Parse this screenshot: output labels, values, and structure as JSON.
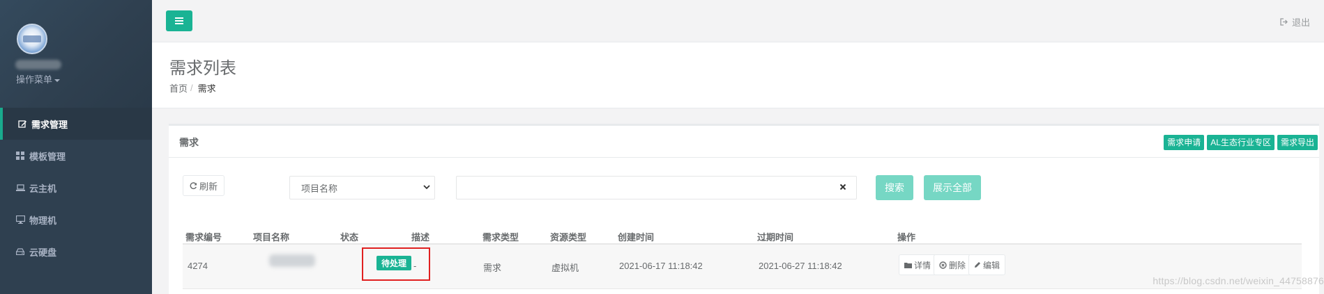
{
  "sidebar": {
    "ops_menu_label": "操作菜单",
    "items": [
      {
        "label": "需求管理",
        "icon": "edit-icon",
        "active": true
      },
      {
        "label": "模板管理",
        "icon": "grid-icon",
        "active": false
      },
      {
        "label": "云主机",
        "icon": "laptop-icon",
        "active": false
      },
      {
        "label": "物理机",
        "icon": "desktop-icon",
        "active": false
      },
      {
        "label": "云硬盘",
        "icon": "hdd-icon",
        "active": false
      }
    ]
  },
  "topbar": {
    "logout_label": "退出"
  },
  "heading": {
    "title": "需求列表",
    "breadcrumb": [
      "首页",
      "需求"
    ]
  },
  "panel": {
    "title": "需求",
    "tools": [
      "需求申请",
      "AL生态行业专区",
      "需求导出"
    ]
  },
  "filters": {
    "refresh_label": "刷新",
    "select_value": "项目名称",
    "search_value": "",
    "search_label": "搜索",
    "show_all_label": "展示全部"
  },
  "table": {
    "columns": [
      "需求编号",
      "项目名称",
      "状态",
      "描述",
      "需求类型",
      "资源类型",
      "创建时间",
      "过期时间",
      "操作"
    ],
    "rows": [
      {
        "id": "4274",
        "status": "待处理",
        "description": "-",
        "demand_type": "需求",
        "resource_type": "虚拟机",
        "created": "2021-06-17 11:18:42",
        "expires": "2021-06-27 11:18:42",
        "actions": [
          "详情",
          "删除",
          "编辑"
        ]
      }
    ]
  },
  "watermark": "https://blog.csdn.net/weixin_44758876",
  "colors": {
    "sidebar_bg": "#2f4050",
    "accent": "#1ab394",
    "accent_light": "#76d7c4",
    "highlight_border": "#e02020"
  }
}
